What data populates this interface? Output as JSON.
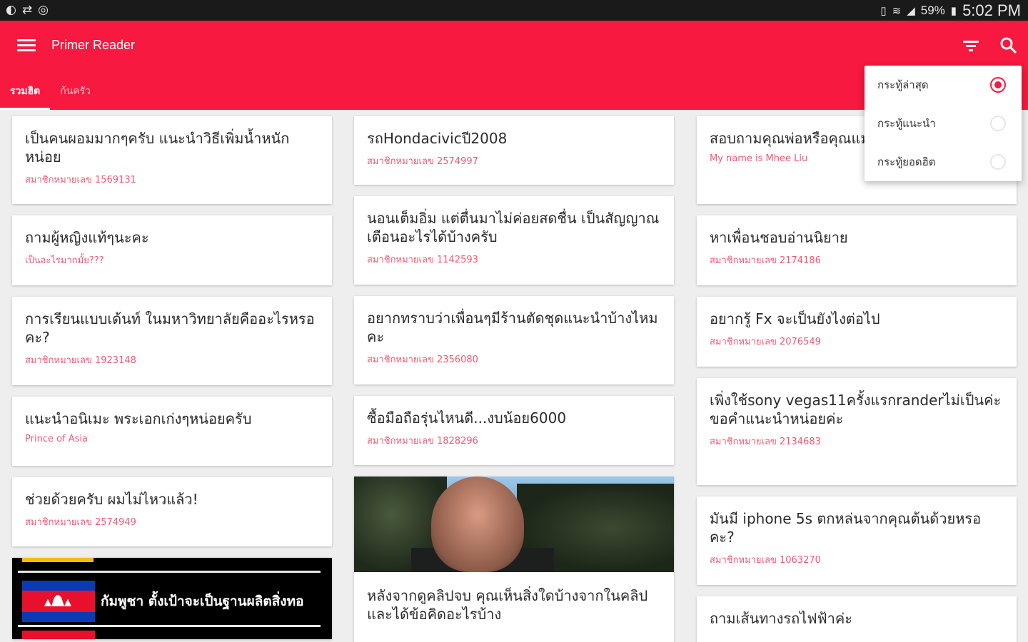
{
  "status_bar": {
    "battery_percent": "59%",
    "time": "5:02 PM",
    "left_icons": [
      "volume-icon",
      "sync-icon",
      "compass-icon"
    ],
    "right_icons": [
      "vibrate-icon",
      "wifi-icon",
      "signal-icon",
      "battery-icon"
    ]
  },
  "app_bar": {
    "title": "Primer Reader",
    "background_color": "#f7193f",
    "tabs": [
      {
        "label": "รวมฮิต",
        "active": true
      },
      {
        "label": "ก้นครัว",
        "active": false
      }
    ]
  },
  "sort_menu": {
    "options": [
      {
        "label": "กระทู้ล่าสุด",
        "selected": true
      },
      {
        "label": "กระทู้แนะนำ",
        "selected": false
      },
      {
        "label": "กระทู้ยอดฮิต",
        "selected": false
      }
    ]
  },
  "columns": [
    [
      {
        "title": "เป็นคนผอมมากๆครับ แนะนำวิธีเพิ่มน้ำหนักหน่อย",
        "sub": "สมาชิกหมายเลข 1569131"
      },
      {
        "title": "ถามผู้หญิงแท้ๆนะคะ",
        "sub": "เป็นอะไรมากมั้ย???"
      },
      {
        "title": "การเรียนแบบเด้นท์ ในมหาวิทยาลัยคืออะไรหรอคะ?",
        "sub": "สมาชิกหมายเลข 1923148"
      },
      {
        "title": "แนะนำอนิเมะ พระเอกเก่งๆหน่อยครับ",
        "sub": "Prince of Asia"
      },
      {
        "title": "ช่วยด้วยครับ ผมไม่ไหวแล้ว!",
        "sub": "สมาชิกหมายเลข 2574949"
      },
      {
        "image_caption": "กัมพูชา ตั้งเป้าจะเป็นฐานผลิตสิ่งทอ"
      }
    ],
    [
      {
        "title": "รถHondacivicปี2008",
        "sub": "สมาชิกหมายเลข 2574997"
      },
      {
        "title": "นอนเต็มอิ่ม แต่ตื่นมาไม่ค่อยสดชื่น เป็นสัญญาณเตือนอะไรได้บ้างครับ",
        "sub": "สมาชิกหมายเลข 1142593"
      },
      {
        "title": "อยากทราบว่าเพื่อนๆมีร้านตัดชุดแนะนำบ้างไหมคะ",
        "sub": "สมาชิกหมายเลข 2356080"
      },
      {
        "title": "ซื้อมือถือรุ่นไหนดี...งบน้อย6000",
        "sub": "สมาชิกหมายเลข 1828296"
      },
      {
        "title": "หลังจากดูคลิปจบ คุณเห็นสิ่งใดบ้างจากในคลิปและได้ข้อคิดอะไรบ้าง",
        "sub": ""
      }
    ],
    [
      {
        "title": "สอบถามคุณพ่อหรือคุณแม่ ด้วยรถไฟค่ะ",
        "sub": "My name is Mhee Liu"
      },
      {
        "title": "หาเพื่อนชอบอ่านนิยาย",
        "sub": "สมาชิกหมายเลข 2174186"
      },
      {
        "title": "อยากรู้ Fx จะเป็นยังไงต่อไป",
        "sub": "สมาชิกหมายเลข 2076549"
      },
      {
        "title": "เพิ่งใช้sony vegas11ครั้งแรกranderไม่เป็นค่ะขอคำแนะนำหน่อยค่ะ",
        "sub": "สมาชิกหมายเลข 2134683"
      },
      {
        "title": "มันมี iphone 5s ตกหล่นจากคุณต้นด้วยหรอคะ?",
        "sub": "สมาชิกหมายเลข 1063270"
      },
      {
        "title": "ถามเส้นทางรถไฟฟ้าค่ะ",
        "sub": ""
      }
    ]
  ]
}
